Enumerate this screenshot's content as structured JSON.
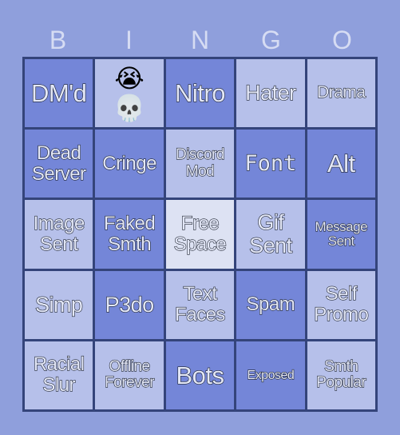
{
  "title_letters": [
    "B",
    "I",
    "N",
    "G",
    "O"
  ],
  "colors": {
    "background": "#8f9fdc",
    "cell_dark": "#7486d8",
    "cell_light": "#b6c0ea",
    "cell_free": "#dde2f3",
    "grid_border": "#34447a",
    "header_text": "#d6dcf3"
  },
  "cells": [
    {
      "text": "DM'd",
      "shade": "dark",
      "size": "s-xl"
    },
    {
      "text": "",
      "emoji": [
        "😭",
        "💀"
      ],
      "emoji_names": [
        "loudly-crying-face-icon",
        "skull-icon"
      ],
      "shade": "light",
      "size": ""
    },
    {
      "text": "Nitro",
      "shade": "dark",
      "size": "s-xl"
    },
    {
      "text": "Hater",
      "shade": "light",
      "size": "s-lg"
    },
    {
      "text": "Drama",
      "shade": "light",
      "size": "s-sm"
    },
    {
      "text": "Dead\nServer",
      "shade": "dark",
      "size": "s-md"
    },
    {
      "text": "Cringe",
      "shade": "dark",
      "size": "s-md"
    },
    {
      "text": "Discord\nMod",
      "shade": "light",
      "size": "s-xs"
    },
    {
      "text": "Font",
      "shade": "dark",
      "size": "s-lg",
      "mono": true
    },
    {
      "text": "Alt",
      "shade": "dark",
      "size": "s-xl"
    },
    {
      "text": "Image\nSent",
      "shade": "light",
      "size": "s-md"
    },
    {
      "text": "Faked\nSmth",
      "shade": "dark",
      "size": "s-md"
    },
    {
      "text": "Free\nSpace",
      "shade": "free",
      "size": "s-md"
    },
    {
      "text": "Gif\nSent",
      "shade": "light",
      "size": "s-lg"
    },
    {
      "text": "Message\nSent",
      "shade": "dark",
      "size": "s-xxs"
    },
    {
      "text": "Simp",
      "shade": "light",
      "size": "s-lg"
    },
    {
      "text": "P3do",
      "shade": "dark",
      "size": "s-lg"
    },
    {
      "text": "Text\nFaces",
      "shade": "light",
      "size": "s-md"
    },
    {
      "text": "Spam",
      "shade": "dark",
      "size": "s-md"
    },
    {
      "text": "Self\nPromo",
      "shade": "light",
      "size": "s-md"
    },
    {
      "text": "Racial\nSlur",
      "shade": "light",
      "size": "s-md"
    },
    {
      "text": "Offline\nForever",
      "shade": "light",
      "size": "s-xs"
    },
    {
      "text": "Bots",
      "shade": "dark",
      "size": "s-xl"
    },
    {
      "text": "Exposed",
      "shade": "dark",
      "size": "s-tiny"
    },
    {
      "text": "Smth\nPopular",
      "shade": "light",
      "size": "s-xs"
    }
  ]
}
